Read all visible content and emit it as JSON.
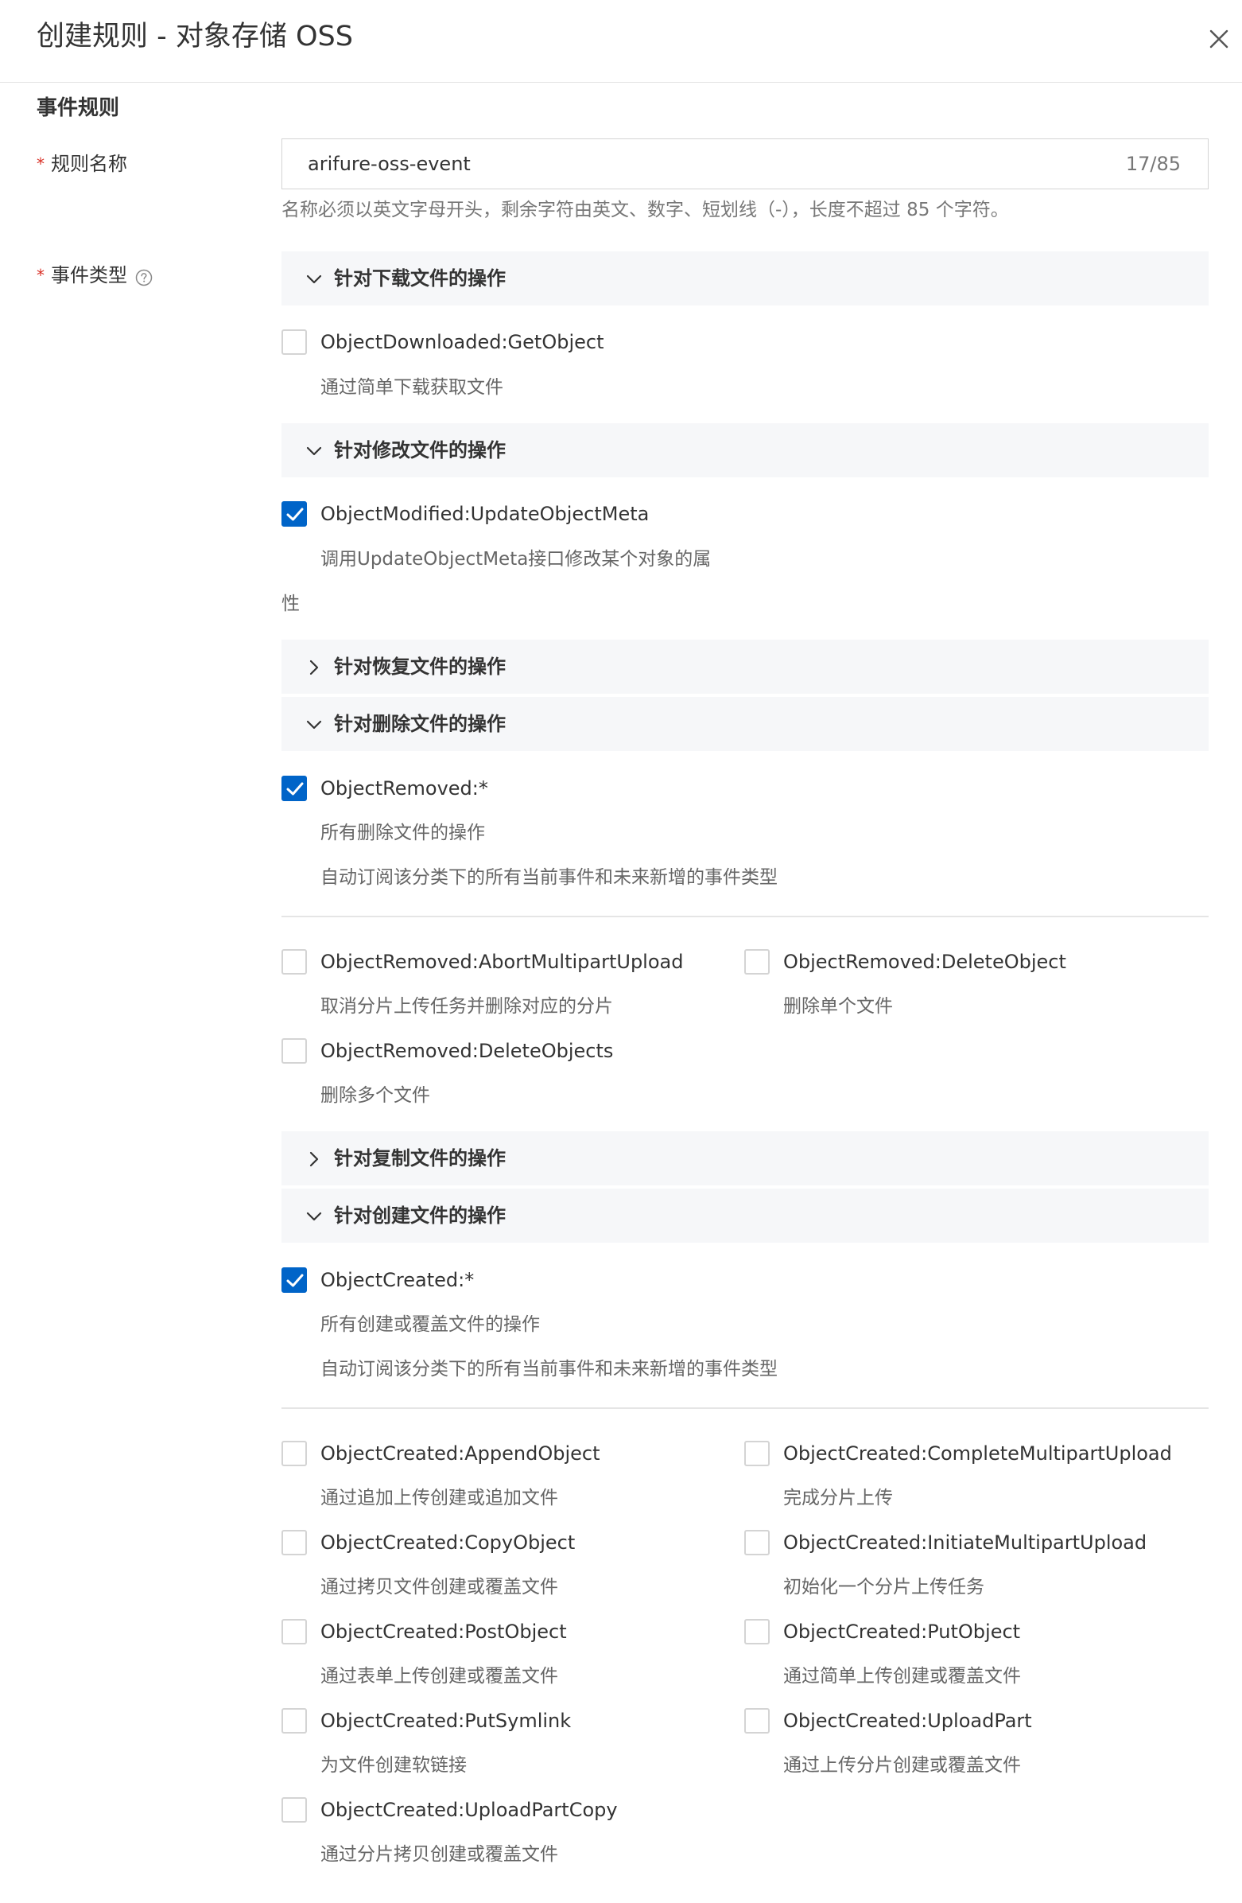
{
  "dialog": {
    "title": "创建规则 - 对象存储 OSS",
    "close_icon": "close-icon"
  },
  "section": {
    "title": "事件规则"
  },
  "form": {
    "rule_name": {
      "required_mark": "*",
      "label": "规则名称",
      "value": "arifure-oss-event",
      "counter": "17/85",
      "hint": "名称必须以英文字母开头，剩余字符由英文、数字、短划线（-），长度不超过 85 个字符。"
    },
    "event_type": {
      "required_mark": "*",
      "label": "事件类型",
      "help_icon": "question-circle-icon"
    }
  },
  "groups": {
    "download": {
      "title": "针对下载文件的操作",
      "expanded": true
    },
    "modify": {
      "title": "针对修改文件的操作",
      "expanded": true
    },
    "restore": {
      "title": "针对恢复文件的操作",
      "expanded": false
    },
    "delete": {
      "title": "针对删除文件的操作",
      "expanded": true
    },
    "copy": {
      "title": "针对复制文件的操作",
      "expanded": false
    },
    "create": {
      "title": "针对创建文件的操作",
      "expanded": true
    }
  },
  "events": {
    "download_getobject": {
      "label": "ObjectDownloaded:GetObject",
      "desc": "通过简单下载获取文件",
      "checked": false
    },
    "modify_updatemeta": {
      "label": "ObjectModified:UpdateObjectMeta",
      "desc": "调用UpdateObjectMeta接口修改某个对象的属",
      "desc2": "性",
      "checked": true
    },
    "removed_all": {
      "label": "ObjectRemoved:*",
      "desc": "所有删除文件的操作",
      "desc2": "自动订阅该分类下的所有当前事件和未来新增的事件类型",
      "checked": true
    },
    "removed_abort": {
      "label": "ObjectRemoved:AbortMultipartUpload",
      "desc": "取消分片上传任务并删除对应的分片",
      "checked": false
    },
    "removed_delete": {
      "label": "ObjectRemoved:DeleteObject",
      "desc": "删除单个文件",
      "checked": false
    },
    "removed_deletes": {
      "label": "ObjectRemoved:DeleteObjects",
      "desc": "删除多个文件",
      "checked": false
    },
    "created_all": {
      "label": "ObjectCreated:*",
      "desc": "所有创建或覆盖文件的操作",
      "desc2": "自动订阅该分类下的所有当前事件和未来新增的事件类型",
      "checked": true
    },
    "created_append": {
      "label": "ObjectCreated:AppendObject",
      "desc": "通过追加上传创建或追加文件",
      "checked": false
    },
    "created_complete": {
      "label": "ObjectCreated:CompleteMultipartUpload",
      "desc": "完成分片上传",
      "checked": false
    },
    "created_copy": {
      "label": "ObjectCreated:CopyObject",
      "desc": "通过拷贝文件创建或覆盖文件",
      "checked": false
    },
    "created_initiate": {
      "label": "ObjectCreated:InitiateMultipartUpload",
      "desc": "初始化一个分片上传任务",
      "checked": false
    },
    "created_post": {
      "label": "ObjectCreated:PostObject",
      "desc": "通过表单上传创建或覆盖文件",
      "checked": false
    },
    "created_put": {
      "label": "ObjectCreated:PutObject",
      "desc": "通过简单上传创建或覆盖文件",
      "checked": false
    },
    "created_symlink": {
      "label": "ObjectCreated:PutSymlink",
      "desc": "为文件创建软链接",
      "checked": false
    },
    "created_uploadpart": {
      "label": "ObjectCreated:UploadPart",
      "desc": "通过上传分片创建或覆盖文件",
      "checked": false
    },
    "created_uploadpartcopy": {
      "label": "ObjectCreated:UploadPartCopy",
      "desc": "通过分片拷贝创建或覆盖文件",
      "checked": false
    }
  },
  "colors": {
    "primary": "#0064c8",
    "required": "#d93026",
    "group_bg": "#f6f7f9",
    "border": "#d4d4d4",
    "muted_text": "#666666"
  }
}
